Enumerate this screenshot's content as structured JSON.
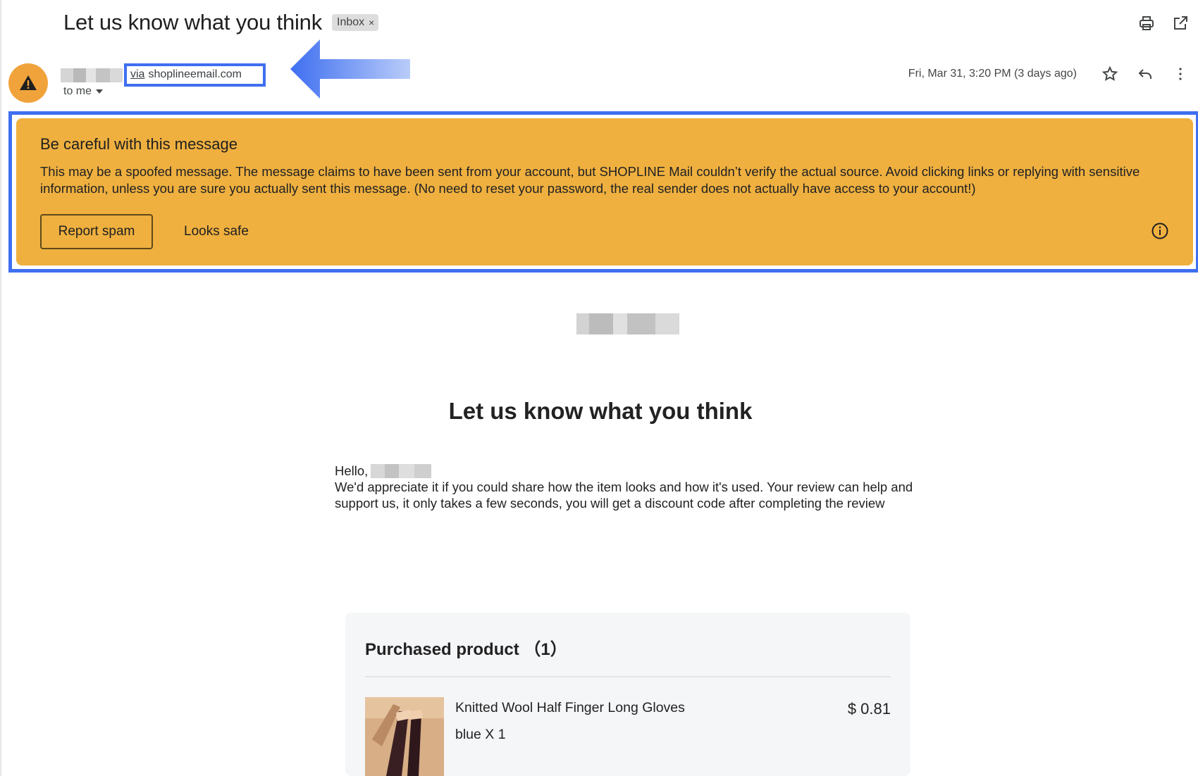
{
  "header": {
    "subject": "Let us know what you think",
    "label": "Inbox",
    "label_remove": "×"
  },
  "icons": {
    "print": "print-icon",
    "open_new_window": "open-in-new-window-icon",
    "star": "star-icon",
    "reply": "reply-icon",
    "more": "more-vert-icon",
    "avatar_warning": "warning-icon",
    "info": "info-icon"
  },
  "sender": {
    "via_word": "via",
    "via_domain": "shoplineemail.com",
    "recipient": "to me",
    "date": "Fri, Mar 31, 3:20 PM (3 days ago)"
  },
  "warning": {
    "title": "Be careful with this message",
    "text": "This may be a spoofed message. The message claims to have been sent from your account, but SHOPLINE Mail couldn’t verify the actual source. Avoid clicking links or replying with sensitive information, unless you are sure you actually sent this message. (No need to reset your password, the real sender does not actually have access to your account!)",
    "report_spam": "Report spam",
    "looks_safe": "Looks safe"
  },
  "colors": {
    "warning_bg": "#efb03f",
    "annotation_blue": "#3f6ff0",
    "avatar": "#f1a33b"
  },
  "body": {
    "heading": "Let us know what you think",
    "greeting": "Hello,",
    "paragraph": "We'd appreciate it if you could share how the item looks and how it's used. Your review can help and support us, it only takes a few seconds, you will get a discount code after completing the review"
  },
  "product": {
    "heading": "Purchased product （1）",
    "name": "Knitted Wool Half Finger Long Gloves",
    "variant": "blue X 1",
    "price": "$ 0.81"
  }
}
